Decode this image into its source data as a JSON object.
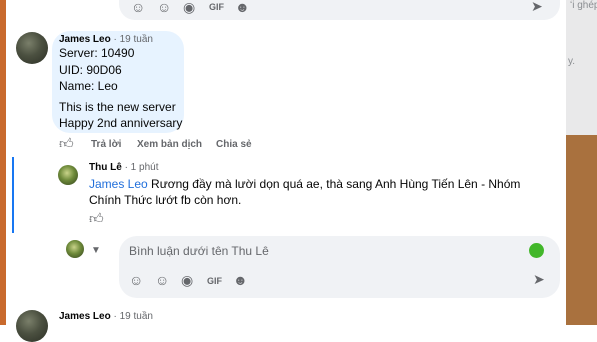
{
  "background": {
    "right_side_text": [
      "ʻi ghép",
      "y."
    ]
  },
  "comment_main": {
    "author": "James Leo",
    "time": "· 19 tuần",
    "lines": [
      "Server: 10490",
      "UID: 90D06",
      "Name: Leo",
      "This is the new server",
      "Happy 2nd anniversary"
    ],
    "actions": {
      "reply": "Trả lời",
      "translate": "Xem bản dịch",
      "share": "Chia sẻ"
    }
  },
  "reply": {
    "author": "Thu Lê",
    "time": "· 1 phút",
    "mention": "James Leo",
    "text_line1": "Rương đầy mà lười dọn quá ae, thà sang Anh Hùng Tiến Lên - Nhóm",
    "text_line2": "Chính Thức lướt fb còn hơn."
  },
  "composer": {
    "placeholder": "Bình luận dưới tên Thu Lê"
  },
  "comment_next": {
    "author": "James Leo",
    "time": "· 19 tuần"
  },
  "colors": {
    "bubble": "#e7f3ff",
    "thread_line": "#1877f2",
    "mention": "#216fdb",
    "composer_bg": "#f0f2f5"
  }
}
